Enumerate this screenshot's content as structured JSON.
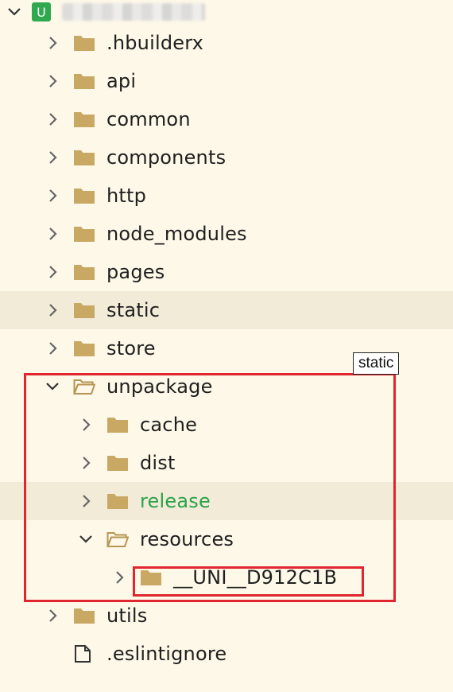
{
  "root": {
    "logo_letter": "U"
  },
  "items": [
    {
      "name": ".hbuilderx",
      "indent": 1,
      "type": "folder",
      "expanded": false
    },
    {
      "name": "api",
      "indent": 1,
      "type": "folder",
      "expanded": false
    },
    {
      "name": "common",
      "indent": 1,
      "type": "folder",
      "expanded": false
    },
    {
      "name": "components",
      "indent": 1,
      "type": "folder",
      "expanded": false
    },
    {
      "name": "http",
      "indent": 1,
      "type": "folder",
      "expanded": false
    },
    {
      "name": "node_modules",
      "indent": 1,
      "type": "folder",
      "expanded": false
    },
    {
      "name": "pages",
      "indent": 1,
      "type": "folder",
      "expanded": false
    },
    {
      "name": "static",
      "indent": 1,
      "type": "folder",
      "expanded": false,
      "hover": true
    },
    {
      "name": "store",
      "indent": 1,
      "type": "folder",
      "expanded": false
    },
    {
      "name": "unpackage",
      "indent": 1,
      "type": "folder",
      "expanded": true
    },
    {
      "name": "cache",
      "indent": 2,
      "type": "folder",
      "expanded": false
    },
    {
      "name": "dist",
      "indent": 2,
      "type": "folder",
      "expanded": false
    },
    {
      "name": "release",
      "indent": 2,
      "type": "folder",
      "expanded": false,
      "hover": true,
      "green": true
    },
    {
      "name": "resources",
      "indent": 2,
      "type": "folder",
      "expanded": true
    },
    {
      "name": "__UNI__D912C1B",
      "indent": 3,
      "type": "folder",
      "expanded": false
    },
    {
      "name": "utils",
      "indent": 1,
      "type": "folder",
      "expanded": false
    },
    {
      "name": ".eslintignore",
      "indent": 1,
      "type": "file"
    }
  ],
  "tooltip": {
    "text": "static"
  },
  "colors": {
    "folder": "#c9a864",
    "highlight_border": "#e0252f",
    "green_text": "#2ca24a"
  }
}
